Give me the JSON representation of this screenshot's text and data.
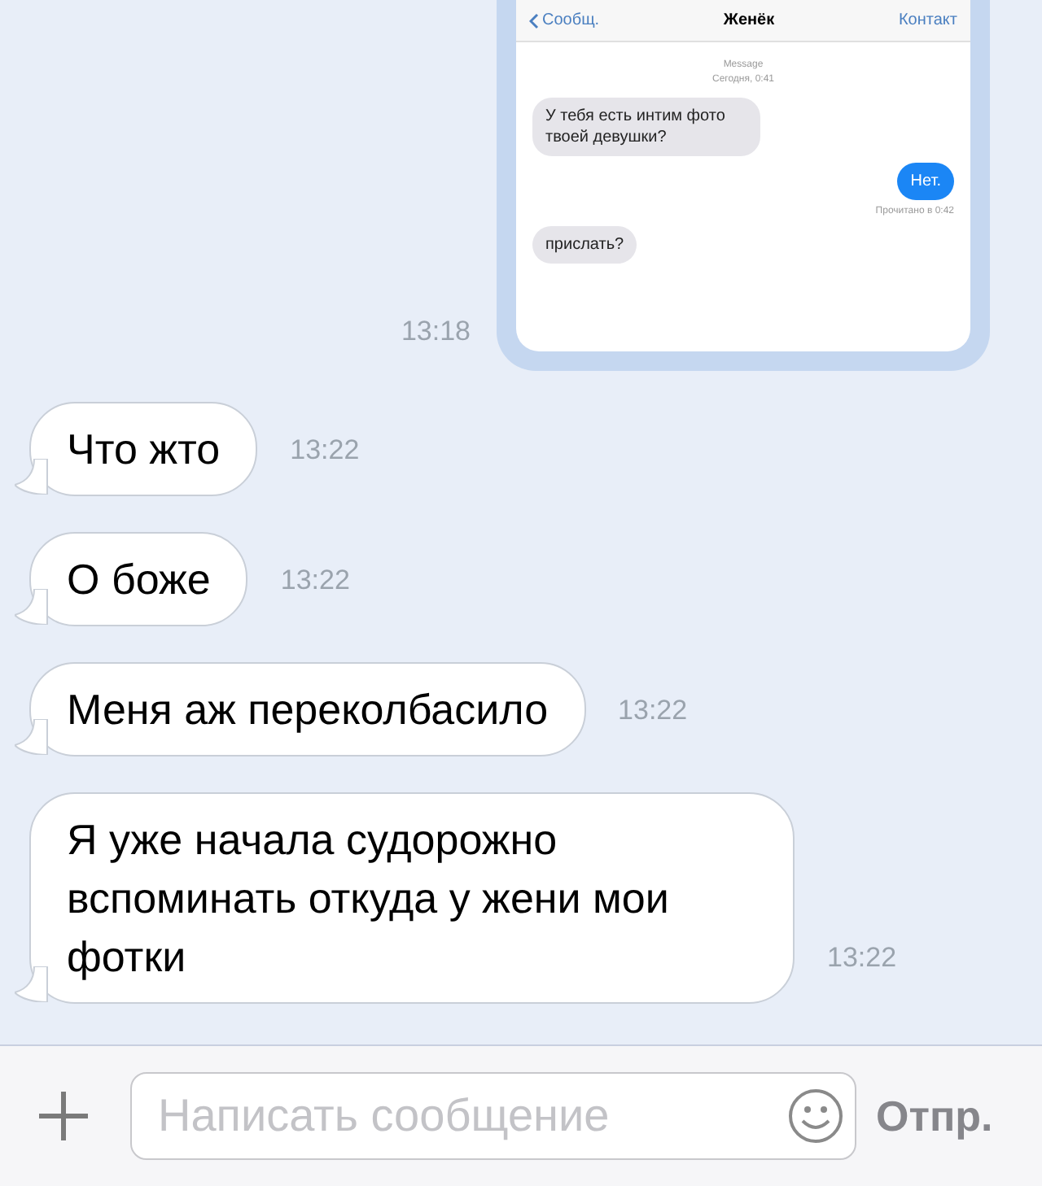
{
  "attachment": {
    "kind": "screenshot",
    "time": "13:18",
    "nav": {
      "back": "Сообщ.",
      "title": "Женёк",
      "action": "Контакт"
    },
    "header": [
      "Message",
      "Сегодня, 0:41"
    ],
    "messages": [
      {
        "text": "У тебя есть интим фото твоей девушки?",
        "outgoing": false
      },
      {
        "text": "Нет.",
        "outgoing": true,
        "receipt": "Прочитано в 0:42"
      },
      {
        "text": "прислать?",
        "outgoing": false
      }
    ]
  },
  "messages": [
    {
      "text": "Что жто",
      "time": "13:22"
    },
    {
      "text": "О боже",
      "time": "13:22"
    },
    {
      "text": "Меня аж переколбасило",
      "time": "13:22"
    },
    {
      "text": "Я уже начала судорожно вспоминать откуда у жени мои фотки",
      "time": "13:22"
    }
  ],
  "composer": {
    "placeholder": "Написать сообщение",
    "send": "Отпр."
  }
}
